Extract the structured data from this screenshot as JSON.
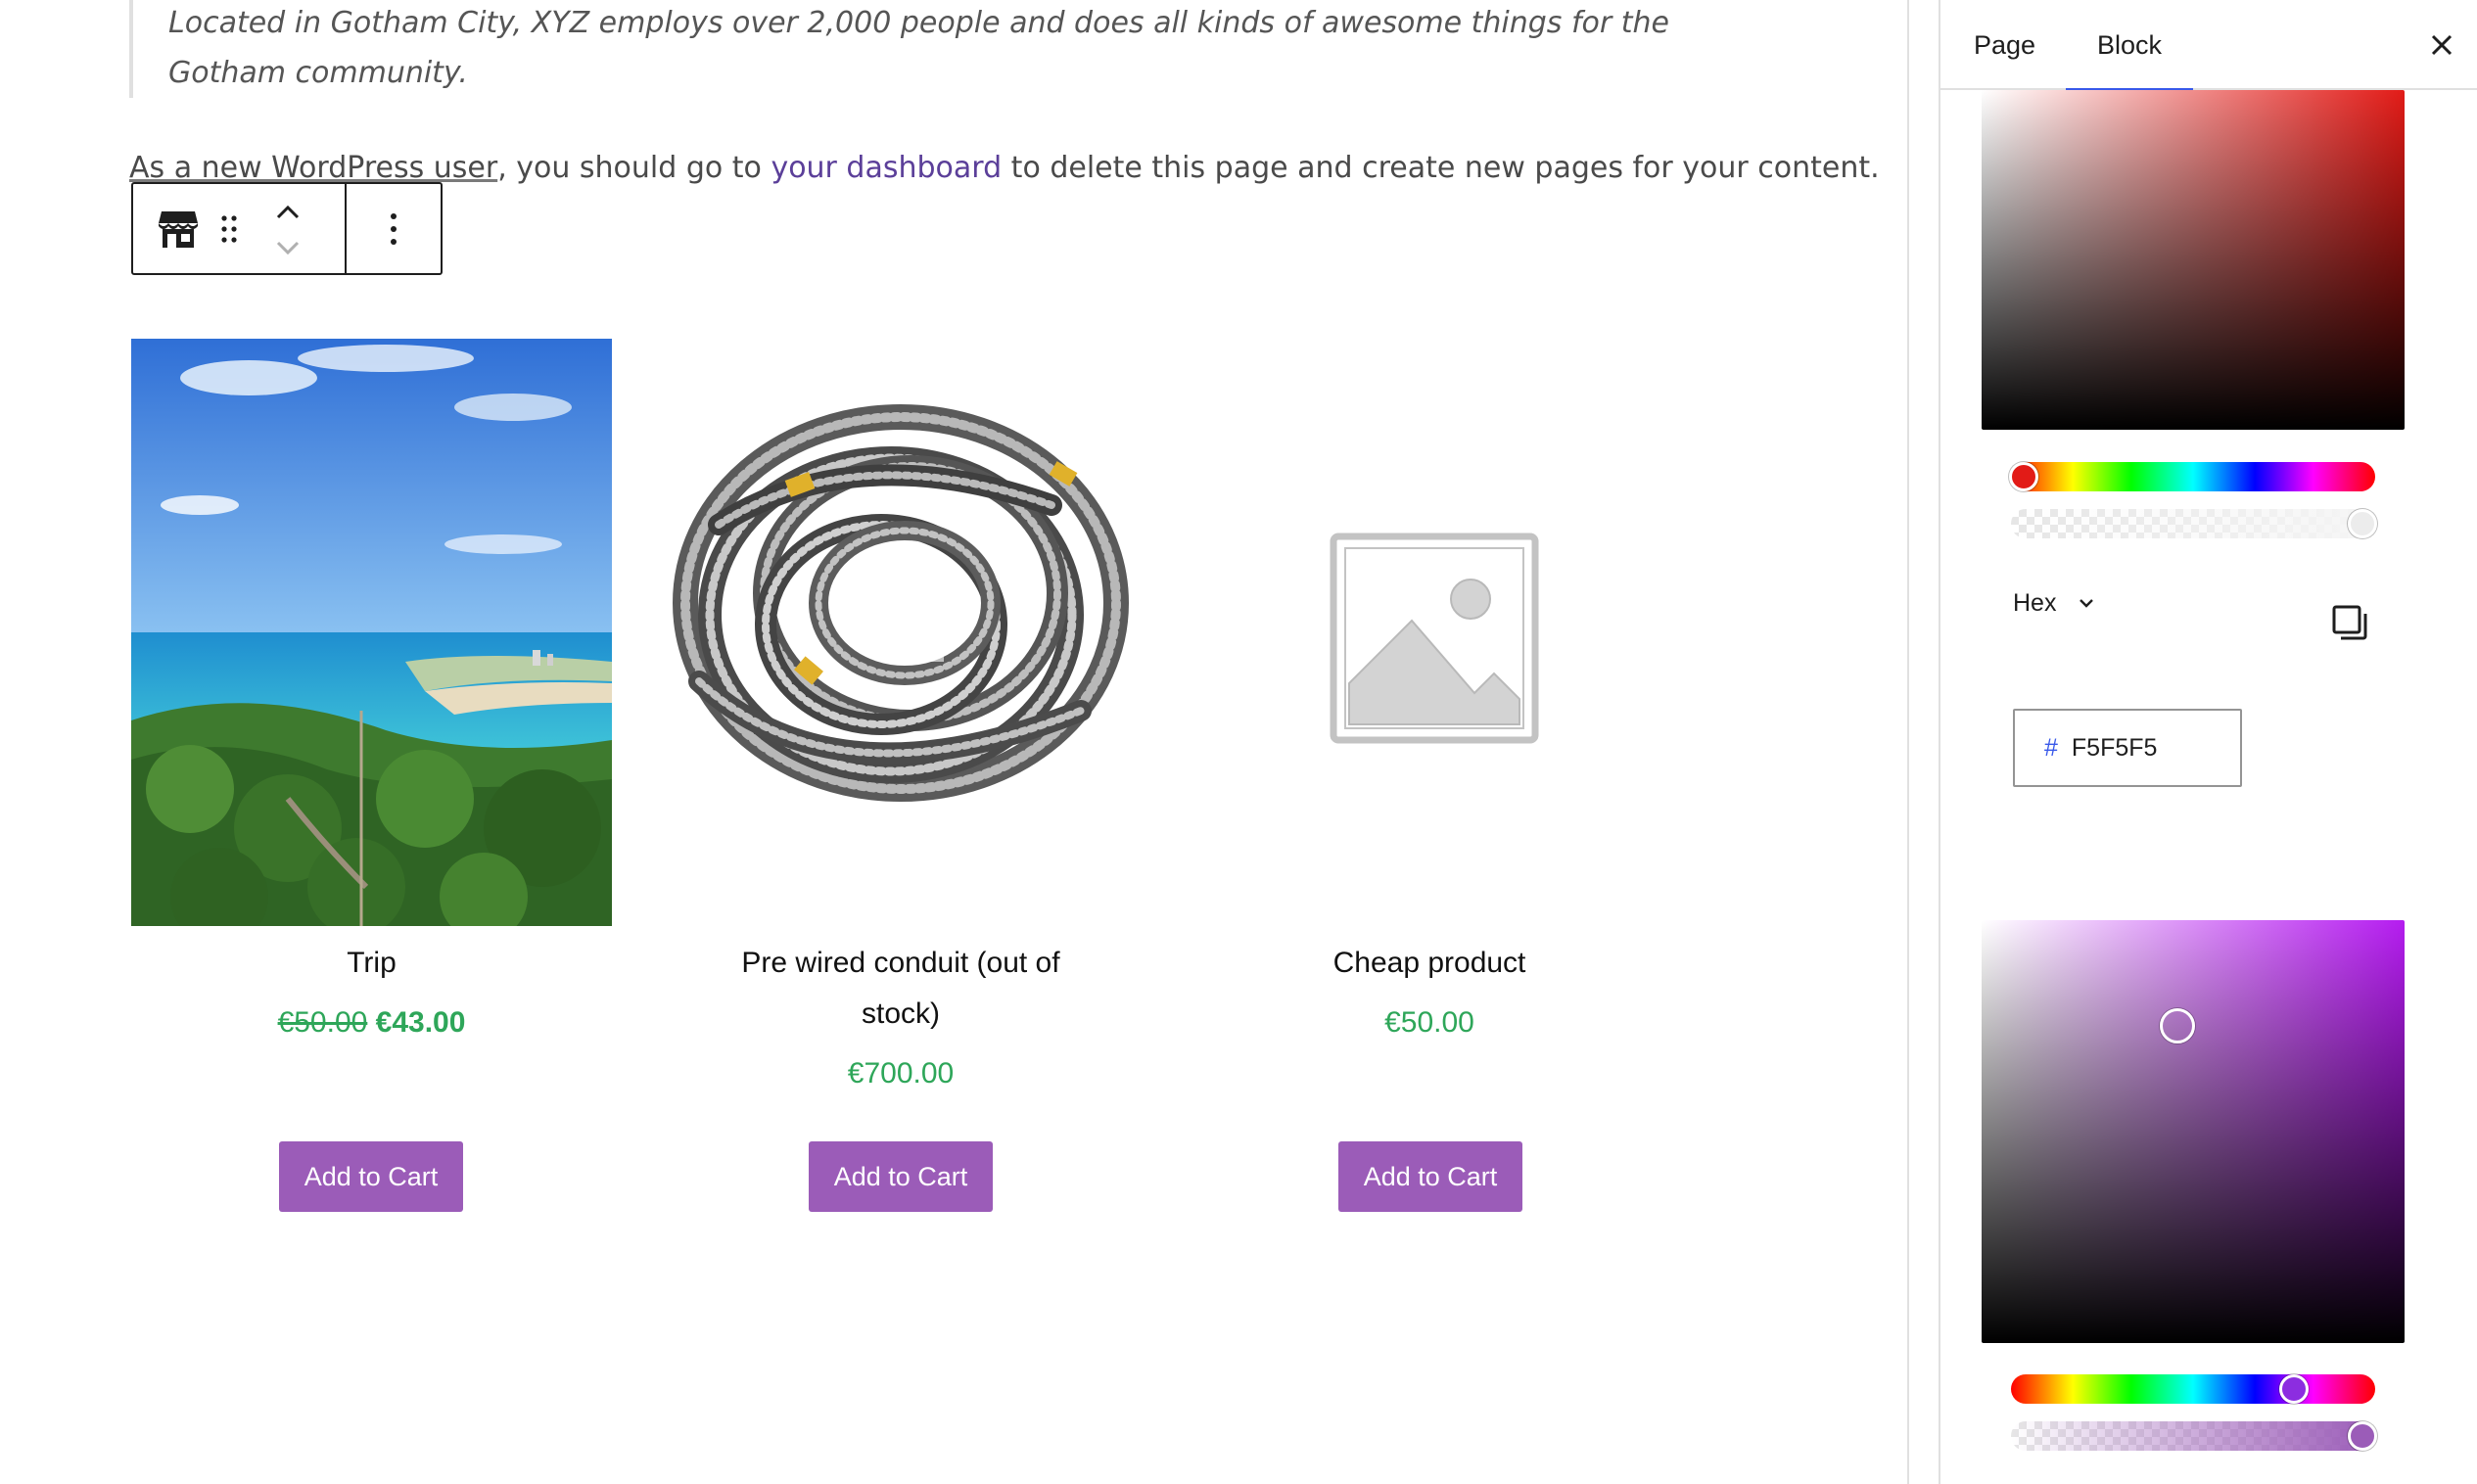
{
  "editor": {
    "quote_text": "Located in Gotham City, XYZ employs over 2,000 people and does all kinds of awesome things for the Gotham community.",
    "intro": {
      "before": "As a new WordPress user",
      "middle": ", you should go to ",
      "link": "your dashboard",
      "after": " to delete this page and create new pages for your content."
    },
    "toolbar": {
      "block_icon": "store-icon",
      "drag_icon": "drag-handle-icon",
      "move_up_icon": "chevron-up-icon",
      "move_down_icon": "chevron-down-icon",
      "options_icon": "more-vertical-icon"
    }
  },
  "products": [
    {
      "title": "Trip",
      "regular_price": "€50.00",
      "sale_price": "€43.00",
      "button": "Add to Cart",
      "image": "beach-landscape-photo"
    },
    {
      "title_line1": "Pre wired conduit (out of",
      "title_line2": "stock)",
      "price": "€700.00",
      "button": "Add to Cart",
      "image": "coiled-conduit-photo"
    },
    {
      "title": "Cheap product",
      "price": "€50.00",
      "button": "Add to Cart",
      "image": "placeholder-image-icon"
    }
  ],
  "sidebar": {
    "tabs": [
      {
        "label": "Page"
      },
      {
        "label": "Block",
        "active": true
      }
    ],
    "close_icon": "close-icon",
    "color_picker_1": {
      "hue_color": "#e21b17",
      "alpha": 1.0
    },
    "format_label": "Hex",
    "format_icon": "chevron-down-icon",
    "copy_icon": "copy-icon",
    "hex": {
      "prefix": "#",
      "value": "F5F5F5"
    },
    "color_picker_2": {
      "hue_color": "#b51cf0",
      "alpha": 1.0
    }
  },
  "colors": {
    "accent": "#3858e9",
    "button": "#9b5cb8",
    "price": "#2ea659",
    "link": "#5b3f99"
  }
}
